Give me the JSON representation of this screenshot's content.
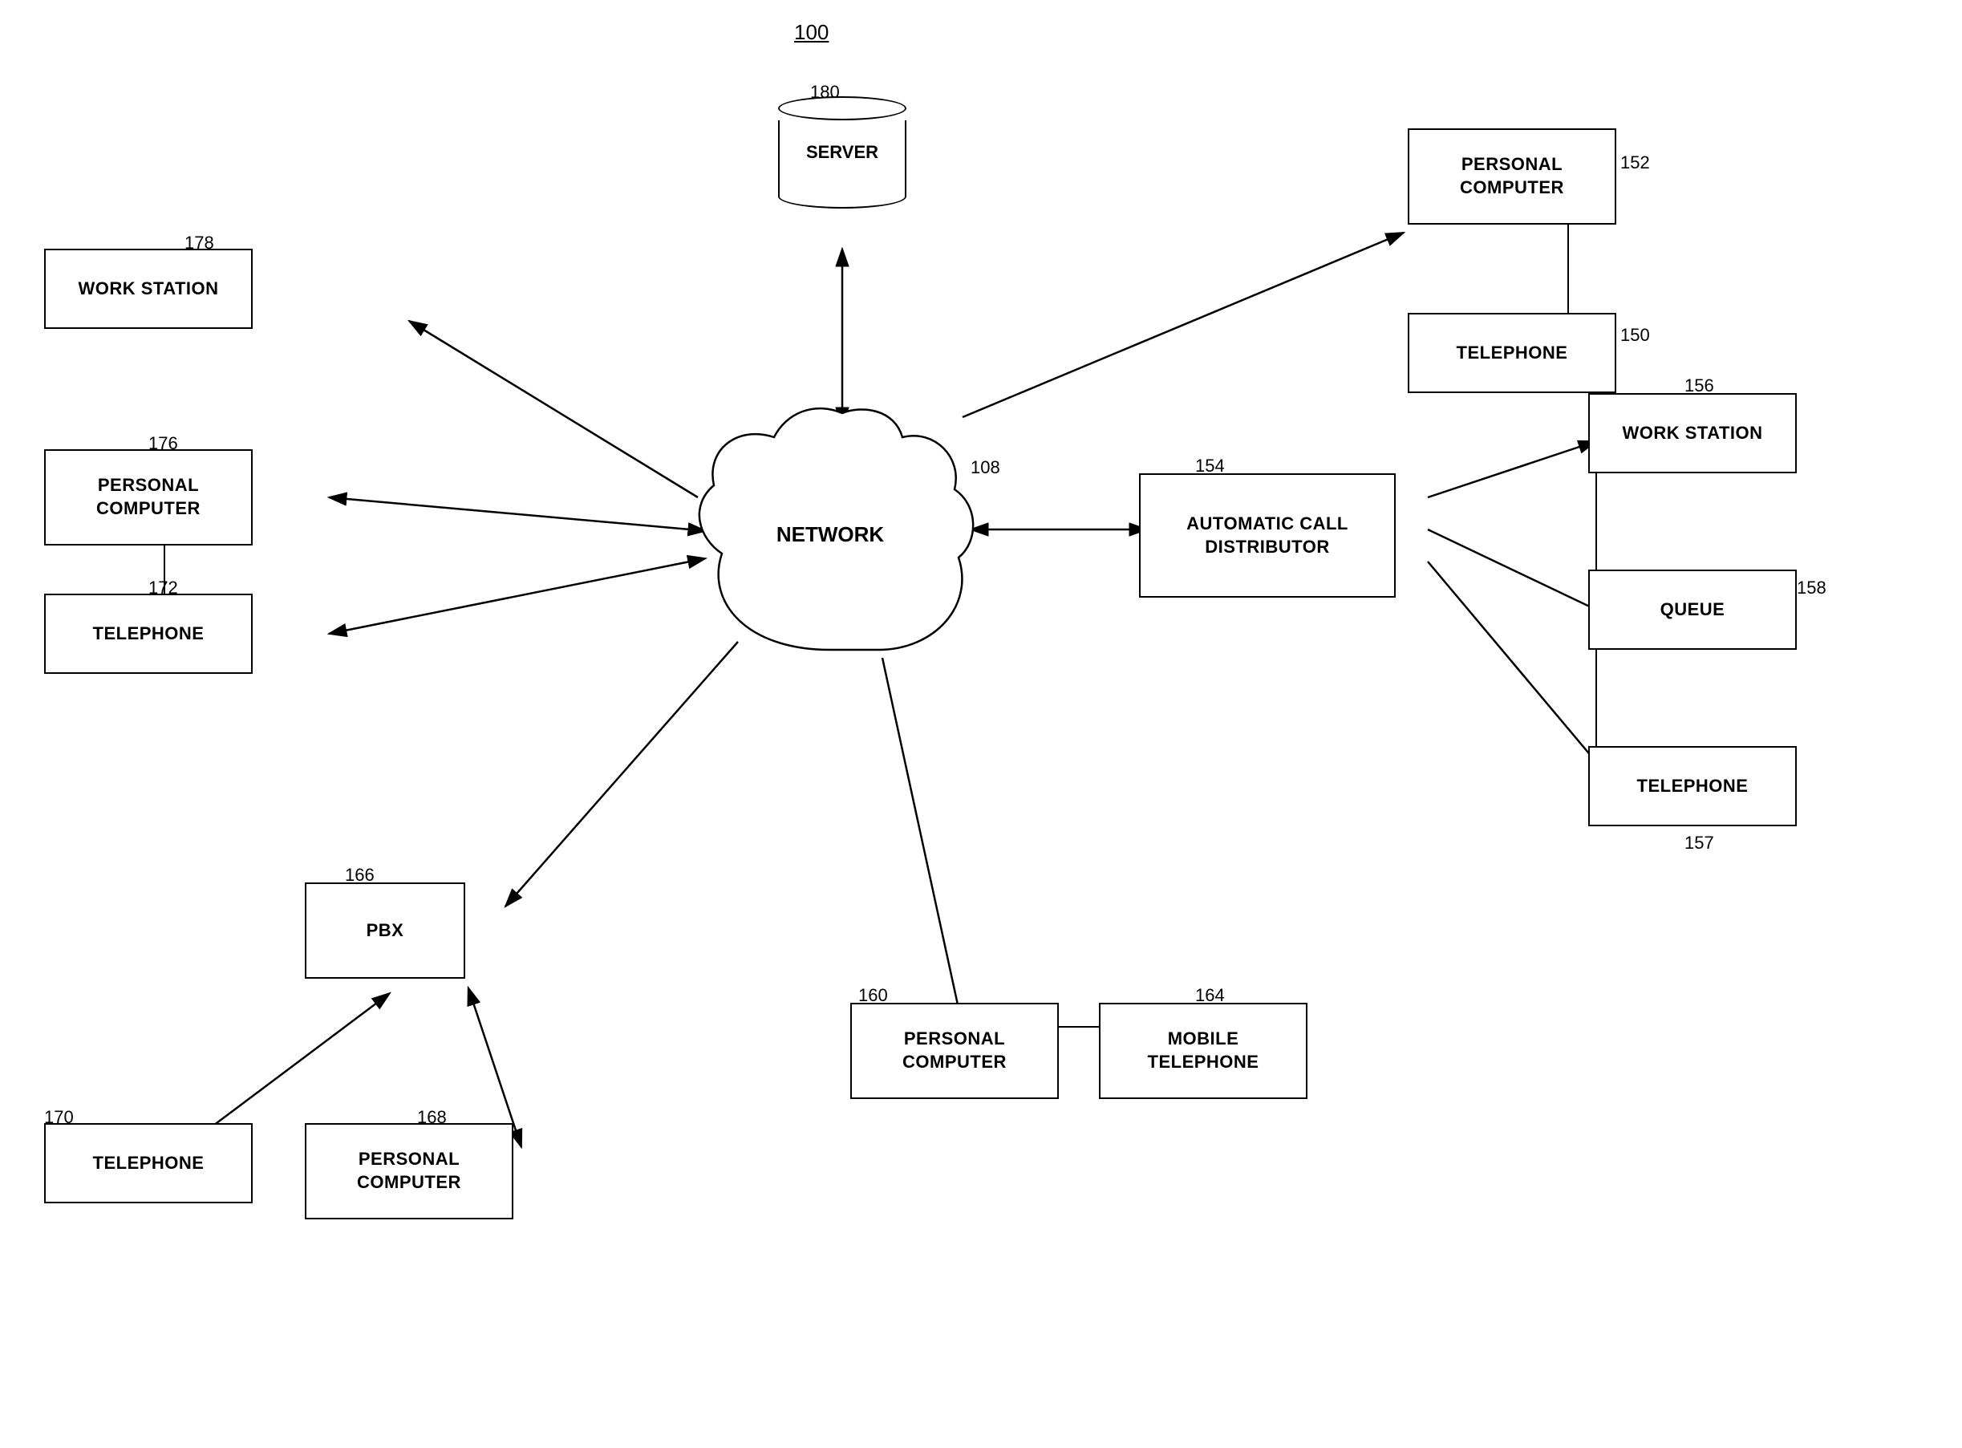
{
  "diagram": {
    "title": "100",
    "nodes": {
      "server": {
        "label": "SERVER",
        "ref": "180"
      },
      "network": {
        "label": "NETWORK",
        "ref": "108"
      },
      "workstation_left": {
        "label": "WORK STATION",
        "ref": "178"
      },
      "personal_computer_left": {
        "label": "PERSONAL\nCOMPUTER",
        "ref": "176"
      },
      "telephone_left": {
        "label": "TELEPHONE",
        "ref": "172"
      },
      "pbx": {
        "label": "PBX",
        "ref": "166"
      },
      "telephone_pbx1": {
        "label": "TELEPHONE",
        "ref": "170"
      },
      "personal_computer_pbx": {
        "label": "PERSONAL\nCOMPUTER",
        "ref": "168"
      },
      "personal_computer_bottom": {
        "label": "PERSONAL\nCOMPUTER",
        "ref": "160"
      },
      "mobile_telephone": {
        "label": "MOBILE\nTELEPHONE",
        "ref": "164"
      },
      "acd": {
        "label": "AUTOMATIC CALL\nDISTRIBUTOR",
        "ref": "154"
      },
      "workstation_right": {
        "label": "WORK STATION",
        "ref": "156"
      },
      "queue": {
        "label": "QUEUE",
        "ref": "158"
      },
      "telephone_right": {
        "label": "TELEPHONE",
        "ref": "157"
      },
      "personal_computer_top_right": {
        "label": "PERSONAL\nCOMPUTER",
        "ref": "152"
      },
      "telephone_top_right": {
        "label": "TELEPHONE",
        "ref": "150"
      }
    }
  }
}
